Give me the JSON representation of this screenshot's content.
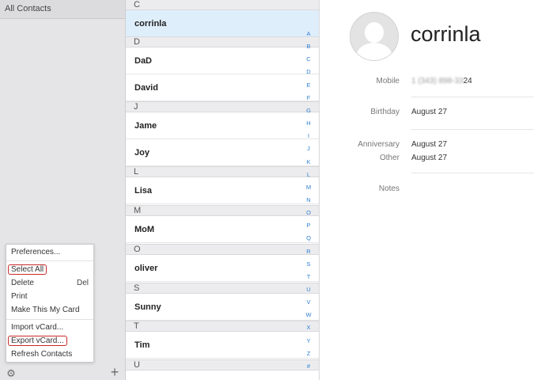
{
  "sidebar": {
    "group_label": "All Contacts",
    "menu": {
      "preferences": "Preferences...",
      "select_all": "Select All",
      "delete": "Delete",
      "delete_shortcut": "Del",
      "print": "Print",
      "make_my_card": "Make This My Card",
      "import_vcard": "Import vCard...",
      "export_vcard": "Export vCard...",
      "refresh": "Refresh Contacts"
    },
    "gear_icon": "gear-icon",
    "add_icon": "plus-icon"
  },
  "list": {
    "headers": [
      "C",
      "D",
      "J",
      "L",
      "M",
      "O",
      "S",
      "T",
      "U"
    ],
    "contacts": [
      "corrinla",
      "DaD",
      "David",
      "Jame",
      "Joy",
      "Lisa",
      "MoM",
      "oliver",
      "Sunny",
      "Tim"
    ],
    "selected": "corrinla",
    "alphabet": [
      "A",
      "B",
      "C",
      "D",
      "E",
      "F",
      "G",
      "H",
      "I",
      "J",
      "K",
      "L",
      "M",
      "N",
      "O",
      "P",
      "Q",
      "R",
      "S",
      "T",
      "U",
      "V",
      "W",
      "X",
      "Y",
      "Z",
      "#"
    ]
  },
  "detail": {
    "name": "corrinla",
    "mobile_label": "Mobile",
    "mobile_value_hidden": "1 (343) 898-33",
    "mobile_value_suffix": "24",
    "birthday_label": "Birthday",
    "birthday_value": "August 27",
    "anniversary_label": "Anniversary",
    "anniversary_value": "August 27",
    "other_label": "Other",
    "other_value": "August 27",
    "notes_label": "Notes"
  },
  "colors": {
    "selection": "#dfeefb",
    "index_blue": "#2f7fd2",
    "highlight_red": "#c92a2a"
  }
}
